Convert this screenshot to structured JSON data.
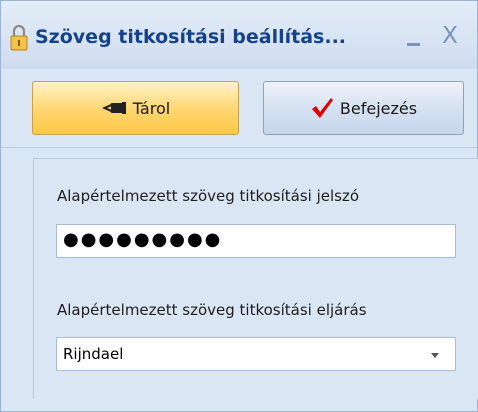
{
  "window": {
    "title": "Szöveg titkosítási beállítás...",
    "minimize_glyph": "_",
    "close_glyph": "X"
  },
  "toolbar": {
    "store_label": "Tárol",
    "store_icon": "pointing-hand-icon",
    "finish_label": "Befejezés",
    "finish_icon": "checkmark-icon",
    "finish_icon_color": "#e00000"
  },
  "form": {
    "password_label": "Alapértelmezett szöveg titkosítási jelszó",
    "password_value": "●●●●●●●●●",
    "algorithm_label": "Alapértelmezett szöveg titkosítási eljárás",
    "algorithm_value": "Rijndael"
  },
  "colors": {
    "title_text": "#15428b",
    "store_button": "#ffd56e",
    "window_bg": "#dbe6f4"
  }
}
